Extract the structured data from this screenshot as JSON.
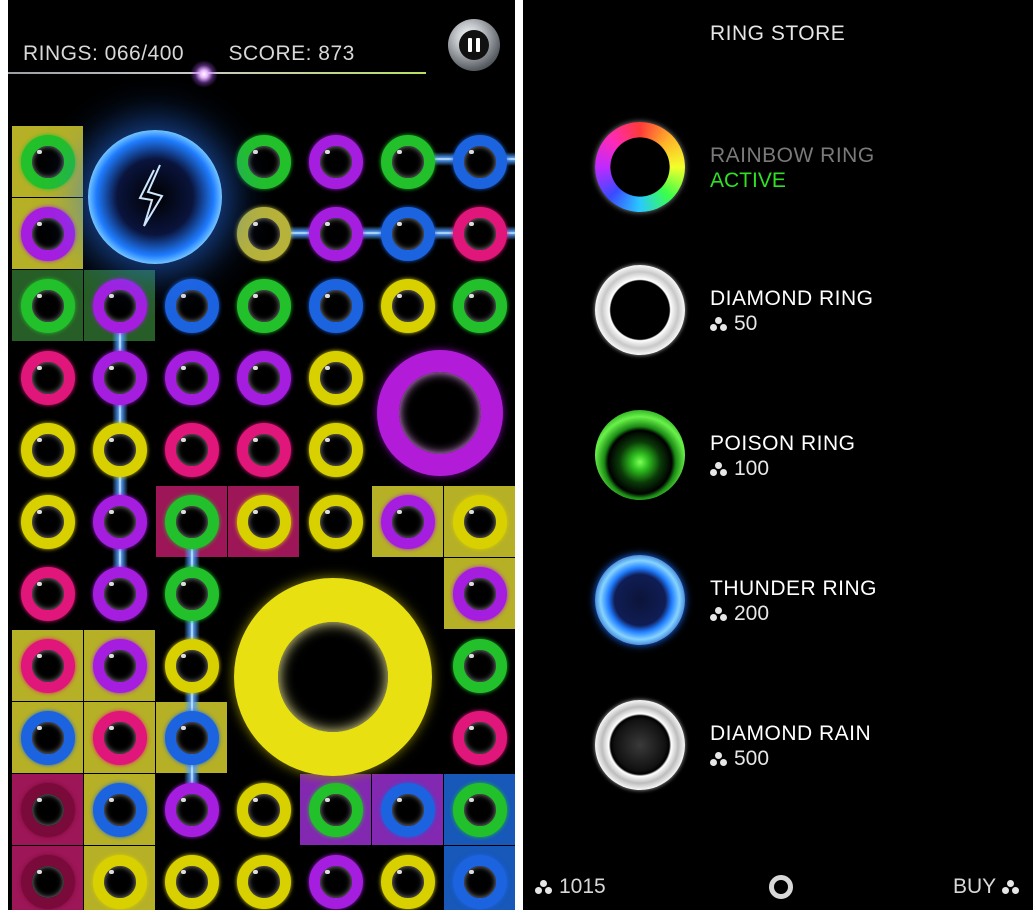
{
  "game": {
    "rings_label": "RINGS: 066/400",
    "score_label": "SCORE: 873",
    "pause_button": "pause-icon",
    "colors": {
      "green": "#22c02a",
      "purple": "#a51ee0",
      "blue": "#1c63e0",
      "yellow": "#d9d000",
      "pink": "#e0167a",
      "olive": "#b7b23a",
      "tile_yellow": "#d6cf2d",
      "tile_green": "#2e6e2e",
      "tile_pink": "#b81a66",
      "tile_purple": "#9a2fd0",
      "tile_blue": "#1b67d9"
    },
    "grid": [
      [
        "green",
        "thunder",
        "thunder",
        "green",
        "purple",
        "green",
        "blue"
      ],
      [
        "purple",
        "thunder",
        "thunder",
        "olive",
        "purple",
        "blue",
        "pink"
      ],
      [
        "green",
        "purple",
        "blue",
        "green",
        "blue",
        "yellow",
        "green"
      ],
      [
        "pink",
        "purple",
        "purple",
        "purple",
        "yellow",
        "bigpurple",
        "bigpurple"
      ],
      [
        "yellow",
        "yellow",
        "pink",
        "pink",
        "yellow",
        "bigpurple",
        "bigpurple"
      ],
      [
        "yellow",
        "purple",
        "green",
        "yellow",
        "yellow",
        "purple",
        "yellow"
      ],
      [
        "pink",
        "purple",
        "green",
        "bigyellow",
        "bigyellow",
        "bigyellow",
        "purple"
      ],
      [
        "pink",
        "purple",
        "yellow",
        "bigyellow",
        "bigyellow",
        "bigyellow",
        "green"
      ],
      [
        "blue",
        "pink",
        "blue",
        "bigyellow",
        "bigyellow",
        "bigyellow",
        "pink"
      ],
      [
        "darkpink",
        "blue",
        "purple",
        "yellow",
        "green",
        "blue",
        "green"
      ],
      [
        "darkpink",
        "yellow",
        "yellow",
        "yellow",
        "purple",
        "yellow",
        "blue"
      ]
    ],
    "tiles": [
      [
        "tile_yellow",
        "none",
        "none",
        "none",
        "none",
        "none",
        "none"
      ],
      [
        "tile_yellow",
        "none",
        "none",
        "none",
        "none",
        "none",
        "none"
      ],
      [
        "tile_green",
        "tile_green",
        "none",
        "none",
        "none",
        "none",
        "none"
      ],
      [
        "none",
        "none",
        "none",
        "none",
        "none",
        "none",
        "none"
      ],
      [
        "none",
        "none",
        "none",
        "none",
        "none",
        "none",
        "none"
      ],
      [
        "none",
        "none",
        "tile_pink",
        "tile_pink",
        "none",
        "tile_yellow",
        "tile_yellow"
      ],
      [
        "none",
        "none",
        "none",
        "none",
        "none",
        "none",
        "tile_yellow"
      ],
      [
        "tile_yellow",
        "tile_yellow",
        "none",
        "none",
        "none",
        "none",
        "none"
      ],
      [
        "tile_yellow",
        "tile_yellow",
        "tile_yellow",
        "none",
        "none",
        "none",
        "none"
      ],
      [
        "tile_pink",
        "tile_yellow",
        "none",
        "none",
        "tile_purple",
        "tile_purple",
        "tile_blue"
      ],
      [
        "tile_pink",
        "tile_yellow",
        "none",
        "none",
        "none",
        "none",
        "tile_blue"
      ]
    ]
  },
  "store": {
    "title": "RING STORE",
    "items": [
      {
        "name": "RAINBOW RING",
        "status": "ACTIVE",
        "price": "",
        "icon": "rainbow-ring-icon",
        "name_color": "#7a7a7a"
      },
      {
        "name": "DIAMOND RING",
        "status": "",
        "price": "50",
        "icon": "diamond-ring-icon",
        "name_color": "#e6e6e6"
      },
      {
        "name": "POISON RING",
        "status": "",
        "price": "100",
        "icon": "poison-ring-icon",
        "name_color": "#e6e6e6"
      },
      {
        "name": "THUNDER RING",
        "status": "",
        "price": "200",
        "icon": "thunder-ring-icon",
        "name_color": "#e6e6e6"
      },
      {
        "name": "DIAMOND RAIN",
        "status": "",
        "price": "500",
        "icon": "diamond-rain-icon",
        "name_color": "#e6e6e6"
      }
    ],
    "balance": "1015",
    "buy_label": "BUY",
    "active_color": "#2fe025"
  }
}
